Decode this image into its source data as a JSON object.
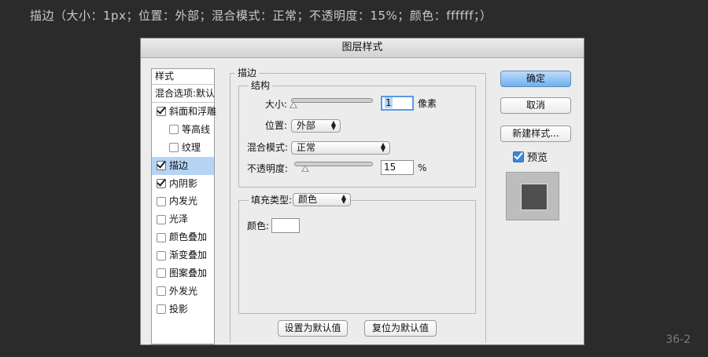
{
  "caption": "描边（大小：1px；位置：外部；混合模式：正常；不透明度：15%；颜色：ffffff；）",
  "figure_number": "36-2",
  "dialog": {
    "title": "图层样式",
    "style_list": {
      "header": "样式",
      "blend_options": "混合选项:默认",
      "items": [
        {
          "label": "斜面和浮雕",
          "checked": true
        },
        {
          "label": "等高线",
          "checked": false,
          "sub": true
        },
        {
          "label": "纹理",
          "checked": false,
          "sub": true
        },
        {
          "label": "描边",
          "checked": true,
          "selected": true
        },
        {
          "label": "内阴影",
          "checked": true
        },
        {
          "label": "内发光",
          "checked": false
        },
        {
          "label": "光泽",
          "checked": false
        },
        {
          "label": "颜色叠加",
          "checked": false
        },
        {
          "label": "渐变叠加",
          "checked": false
        },
        {
          "label": "图案叠加",
          "checked": false
        },
        {
          "label": "外发光",
          "checked": false
        },
        {
          "label": "投影",
          "checked": false
        }
      ]
    },
    "stroke": {
      "group_title": "描边",
      "structure_title": "结构",
      "size_label": "大小:",
      "size_value": "1",
      "size_unit": "像素",
      "position_label": "位置:",
      "position_value": "外部",
      "blend_label": "混合模式:",
      "blend_value": "正常",
      "opacity_label": "不透明度:",
      "opacity_value": "15",
      "opacity_unit": "%",
      "fill_type_label": "填充类型:",
      "fill_type_value": "颜色",
      "color_label": "颜色:",
      "color_value": "#ffffff"
    },
    "buttons": {
      "set_default": "设置为默认值",
      "reset_default": "复位为默认值",
      "ok": "确定",
      "cancel": "取消",
      "new_style": "新建样式...",
      "preview_label": "预览",
      "preview_checked": true
    }
  },
  "colors": {
    "background": "#2b2b2b",
    "dialog_bg": "#ececec",
    "selection": "#b5d3f3",
    "primary_button": "#6fb0ef"
  }
}
